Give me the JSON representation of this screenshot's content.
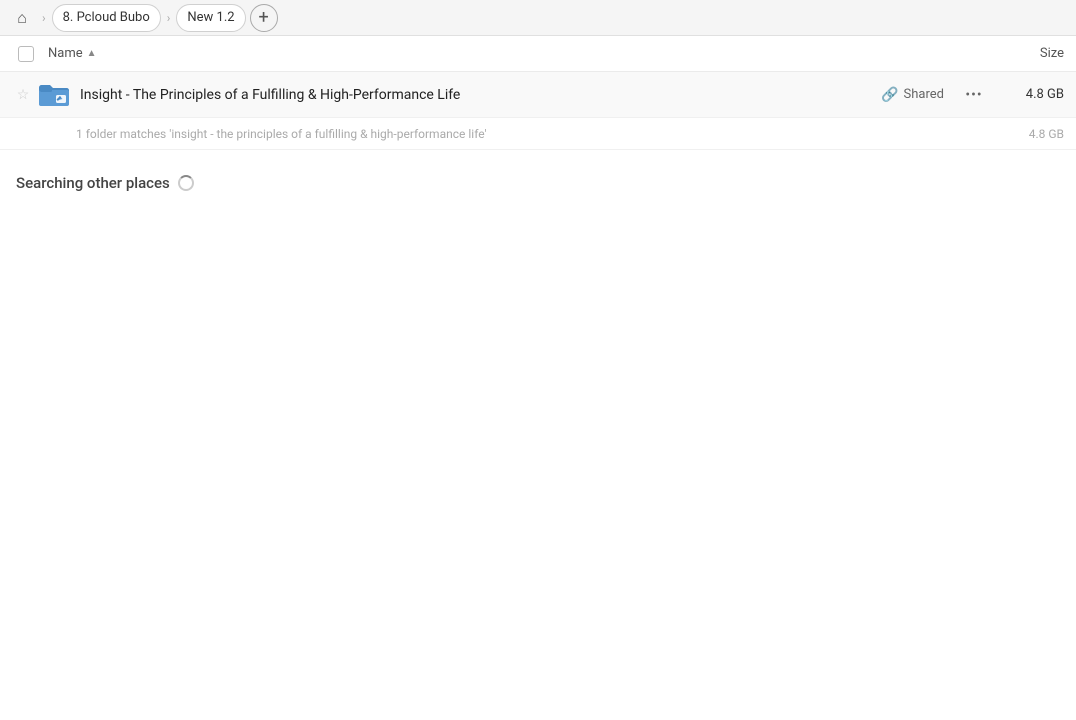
{
  "breadcrumb": {
    "home_icon": "🏠",
    "items": [
      {
        "label": "8. Pcloud Bubo"
      },
      {
        "label": "New 1.2"
      }
    ],
    "add_icon": "+"
  },
  "column_header": {
    "name_label": "Name",
    "size_label": "Size"
  },
  "file_row": {
    "name": "Insight - The Principles of a Fulfilling & High-Performance Life",
    "shared_label": "Shared",
    "size": "4.8 GB",
    "more_icon": "•••"
  },
  "match_info": {
    "text": "1 folder matches 'insight - the principles of a fulfilling & high-performance life'",
    "size": "4.8 GB"
  },
  "searching_section": {
    "label": "Searching other places"
  }
}
